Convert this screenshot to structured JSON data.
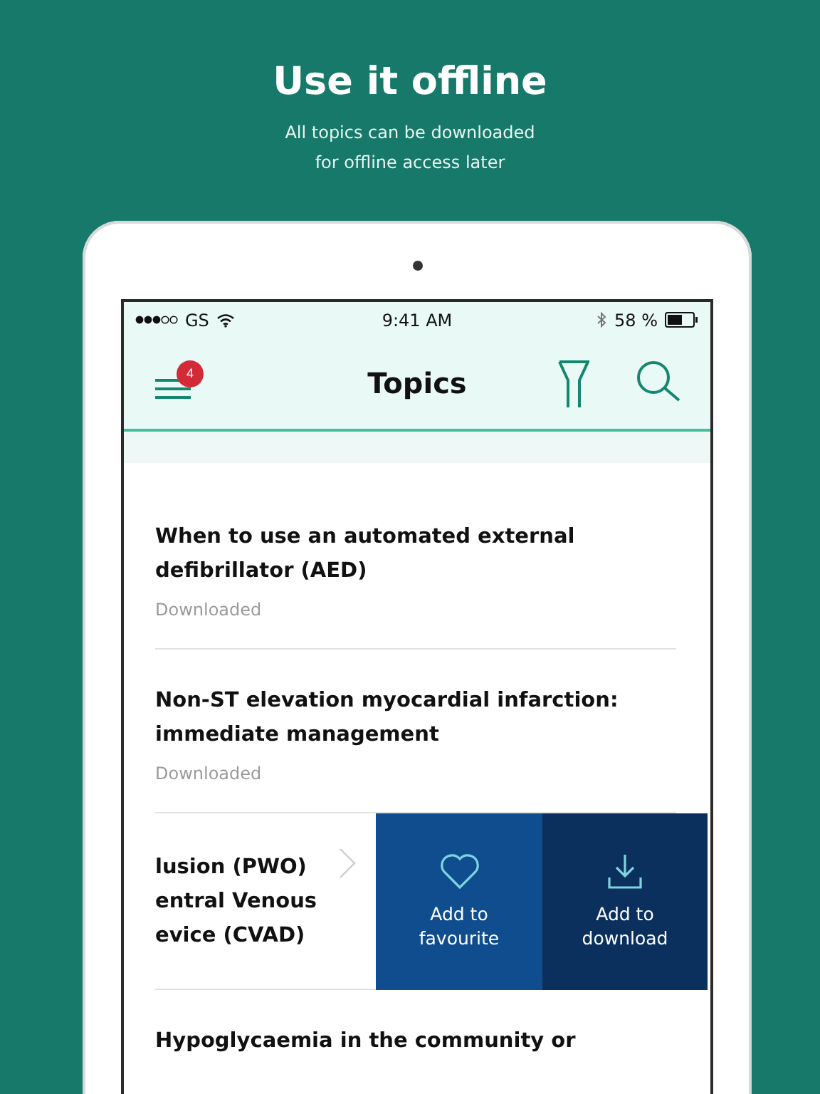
{
  "header": {
    "title": "Use it offline",
    "subtitle": [
      "All topics can be downloaded",
      "for offline access later"
    ]
  },
  "status_bar": {
    "carrier": "GS",
    "time": "9:41 AM",
    "battery": "58 %"
  },
  "nav": {
    "title": "Topics",
    "badge": "4"
  },
  "topics": [
    {
      "kind": "topic",
      "title": [
        "When to use an automated external",
        "defibrillator (AED)"
      ],
      "status": "Downloaded"
    },
    {
      "kind": "topic",
      "title": [
        "Non-ST elevation myocardial infarction:",
        "immediate management"
      ],
      "status": "Downloaded"
    },
    {
      "kind": "swiped",
      "title": [
        "lusion (PWO)",
        "entral Venous",
        "evice (CVAD)"
      ],
      "actions": [
        {
          "kind": "favourite",
          "label": [
            "Add to",
            "favourite"
          ]
        },
        {
          "kind": "download",
          "label": [
            "Add to",
            "download"
          ]
        }
      ]
    },
    {
      "kind": "topic",
      "title": [
        "Hypoglycaemia in the community or"
      ]
    }
  ]
}
